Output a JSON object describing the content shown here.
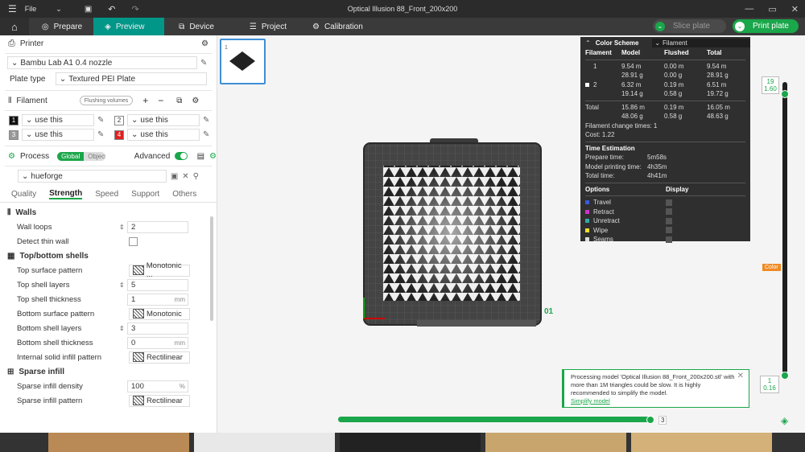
{
  "titlebar": {
    "menu_label": "File",
    "title": "Optical Illusion 88_Front_200x200"
  },
  "nav": {
    "tabs": [
      "Prepare",
      "Preview",
      "Device",
      "Project",
      "Calibration"
    ],
    "active": "Preview",
    "slice_label": "Slice plate",
    "print_label": "Print plate"
  },
  "printer": {
    "header": "Printer",
    "name": "Bambu Lab A1 0.4 nozzle",
    "plate_type_label": "Plate type",
    "plate_type": "Textured PEI Plate"
  },
  "filament": {
    "header": "Filament",
    "flushing_volumes": "Flushing volumes",
    "slots": [
      {
        "num": "1",
        "value": "use this",
        "color": "#111111"
      },
      {
        "num": "2",
        "value": "use this",
        "color": "#ffffff"
      },
      {
        "num": "3",
        "value": "use this",
        "color": "#999999"
      },
      {
        "num": "4",
        "value": "use this",
        "color": "#e02020"
      }
    ]
  },
  "process": {
    "header": "Process",
    "global": "Global",
    "objects": "Objects",
    "advanced": "Advanced",
    "preset": "hueforge",
    "tabs": [
      "Quality",
      "Strength",
      "Speed",
      "Support",
      "Others"
    ],
    "active_tab": "Strength",
    "groups": [
      {
        "title": "Walls",
        "rows": [
          {
            "label": "Wall loops",
            "value": "2",
            "unit": "",
            "kind": "stepper"
          },
          {
            "label": "Detect thin wall",
            "value": "",
            "unit": "",
            "kind": "checkbox"
          }
        ]
      },
      {
        "title": "Top/bottom shells",
        "rows": [
          {
            "label": "Top surface pattern",
            "value": "Monotonic ...",
            "unit": "",
            "kind": "pattern"
          },
          {
            "label": "Top shell layers",
            "value": "5",
            "unit": "",
            "kind": "stepper"
          },
          {
            "label": "Top shell thickness",
            "value": "1",
            "unit": "mm",
            "kind": "text"
          },
          {
            "label": "Bottom surface pattern",
            "value": "Monotonic",
            "unit": "",
            "kind": "pattern"
          },
          {
            "label": "Bottom shell layers",
            "value": "3",
            "unit": "",
            "kind": "stepper"
          },
          {
            "label": "Bottom shell thickness",
            "value": "0",
            "unit": "mm",
            "kind": "text"
          },
          {
            "label": "Internal solid infill pattern",
            "value": "Rectilinear",
            "unit": "",
            "kind": "pattern"
          }
        ]
      },
      {
        "title": "Sparse infill",
        "rows": [
          {
            "label": "Sparse infill density",
            "value": "100",
            "unit": "%",
            "kind": "text"
          },
          {
            "label": "Sparse infill pattern",
            "value": "Rectilinear",
            "unit": "",
            "kind": "pattern"
          }
        ]
      }
    ]
  },
  "stats": {
    "color_scheme_label": "Color Scheme",
    "color_scheme_value": "Filament",
    "headers": [
      "Filament",
      "Model",
      "Flushed",
      "Total"
    ],
    "rows": [
      {
        "id": "1",
        "model": [
          "9.54 m",
          "28.91 g"
        ],
        "flushed": [
          "0.00 m",
          "0.00 g"
        ],
        "total": [
          "9.54 m",
          "28.91 g"
        ]
      },
      {
        "id": "2",
        "model": [
          "6.32 m",
          "19.14 g"
        ],
        "flushed": [
          "0.19 m",
          "0.58 g"
        ],
        "total": [
          "6.51 m",
          "19.72 g"
        ]
      }
    ],
    "total_row": {
      "label": "Total",
      "model": [
        "15.86 m",
        "48.06 g"
      ],
      "flushed": [
        "0.19 m",
        "0.58 g"
      ],
      "total": [
        "16.05 m",
        "48.63 g"
      ]
    },
    "change_times": "Filament change times:  1",
    "cost": "Cost:  1.22",
    "time_title": "Time Estimation",
    "prepare_label": "Prepare time:",
    "prepare": "5m58s",
    "model_label": "Model printing time:",
    "model_time": "4h35m",
    "total_label": "Total time:",
    "total_time": "4h41m",
    "options_label": "Options",
    "display_label": "Display",
    "options": [
      {
        "name": "Travel",
        "color": "#3b5bdb"
      },
      {
        "name": "Retract",
        "color": "#cc33cc"
      },
      {
        "name": "Unretract",
        "color": "#33aaaa"
      },
      {
        "name": "Wipe",
        "color": "#f0e030"
      },
      {
        "name": "Seams",
        "color": "#dddddd"
      }
    ]
  },
  "layers": {
    "top_layer": "19",
    "top_height": "1.60",
    "bottom_layer": "1",
    "bottom_height": "0.16",
    "color_label": "Color",
    "horizontal_value": "3",
    "horizontal_progress": 0.99,
    "plate_label": "01"
  },
  "notification": {
    "text": "Processing model 'Optical Illusion 88_Front_200x200.stl' with more than 1M triangles could be slow. It is highly recommended to simplify the model.",
    "link": "Simplify model"
  },
  "colors": {
    "accent": "#1aa64a",
    "dark": "#2b2b2b",
    "nav": "#3a3a3a",
    "active_tab": "#009688"
  }
}
